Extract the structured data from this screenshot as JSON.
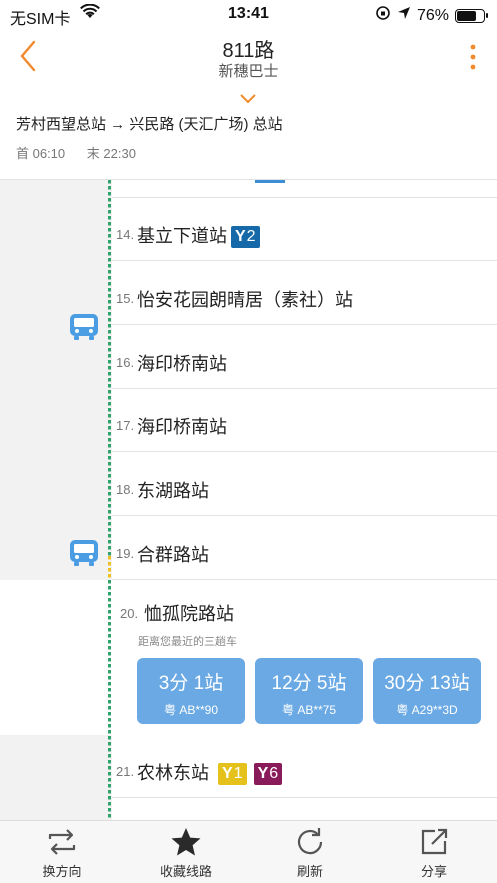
{
  "status_bar": {
    "carrier": "无SIM卡",
    "time": "13:41",
    "battery": "76%",
    "battery_level": 0.76
  },
  "header": {
    "title": "811路",
    "subtitle": "新穗巴士"
  },
  "route": {
    "direction": "芳村西望总站 → 兴民路 (天汇广场) 总站",
    "first_bus": "首 06:10",
    "last_bus": "末 22:30"
  },
  "stops": [
    {
      "num": "14.",
      "name": "基立下道站",
      "metro": [
        {
          "line": "2",
          "color": "#1669a8"
        }
      ]
    },
    {
      "num": "15.",
      "name": "怡安花园朗晴居（素社）站",
      "metro": []
    },
    {
      "num": "16.",
      "name": "海印桥南站",
      "metro": []
    },
    {
      "num": "17.",
      "name": "海印桥南站",
      "metro": []
    },
    {
      "num": "18.",
      "name": "东湖路站",
      "metro": []
    },
    {
      "num": "19.",
      "name": "合群路站",
      "metro": []
    }
  ],
  "current_stop": {
    "num": "20.",
    "name": "恤孤院路站",
    "hint": "距离您最近的三趟车",
    "arrivals": [
      {
        "eta": "3分 1站",
        "plate": "粤 AB**90"
      },
      {
        "eta": "12分 5站",
        "plate": "粤 AB**75"
      },
      {
        "eta": "30分 13站",
        "plate": "粤 A29**3D"
      }
    ]
  },
  "next_stop": {
    "num": "21.",
    "name": "农林东站",
    "metro": [
      {
        "line": "1",
        "color": "#e5c21b"
      },
      {
        "line": "6",
        "color": "#8a1b5a"
      }
    ]
  },
  "tabbar": {
    "reverse": "换方向",
    "favorite": "收藏线路",
    "refresh": "刷新",
    "share": "分享"
  },
  "colors": {
    "accent": "#f08a2c",
    "bus_blue": "#4a9de3",
    "track_green": "#2fa36b",
    "track_yellow": "#f0c020",
    "arrival_card": "#6aa9e4"
  },
  "icons": [
    "back-arrow-icon",
    "more-vertical-icon",
    "chevron-down-icon",
    "bus-icon",
    "metro-icon",
    "swap-icon",
    "star-icon",
    "refresh-icon",
    "share-icon"
  ]
}
